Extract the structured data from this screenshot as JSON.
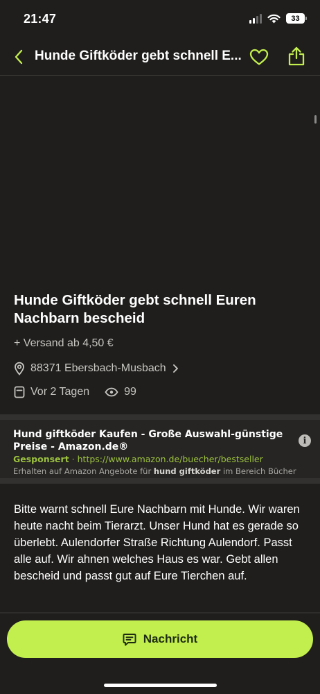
{
  "status_bar": {
    "time": "21:47",
    "battery": "33"
  },
  "nav": {
    "title": "Hunde Giftköder gebt schnell E...",
    "back_icon": "chevron-left-icon",
    "favorite_icon": "heart-icon",
    "share_icon": "share-icon"
  },
  "listing": {
    "title": "Hunde Giftköder gebt schnell Euren Nachbarn bescheid",
    "shipping": "+ Versand ab 4,50 €",
    "location": "88371 Ebersbach-Musbach",
    "posted": "Vor 2 Tagen",
    "views": "99",
    "description": "Bitte warnt schnell Eure Nachbarn mit Hunde. Wir waren heute nacht beim Tierarzt. Unser Hund hat es gerade so überlebt. Aulendorfer Straße Richtung Aulendorf. Passt alle auf. Wir ahnen welches Haus es war. Gebt allen bescheid und passt gut auf Eure Tierchen auf."
  },
  "sponsored": {
    "headline": "Hund giftköder Kaufen - Große Auswahl-günstige Preise - Amazon.de®",
    "label": "Gesponsert",
    "separator": "·",
    "url": "https://www.amazon.de/buecher/bestseller",
    "desc_prefix": "Erhalten auf Amazon Angebote für",
    "desc_bold": "hund giftköder",
    "desc_suffix": "im Bereich Bücher",
    "info": "i"
  },
  "actions": {
    "message_label": "Nachricht"
  },
  "colors": {
    "accent": "#c2ee4e",
    "background": "#1f1e1c",
    "sponsored_green": "#9cc23f"
  }
}
